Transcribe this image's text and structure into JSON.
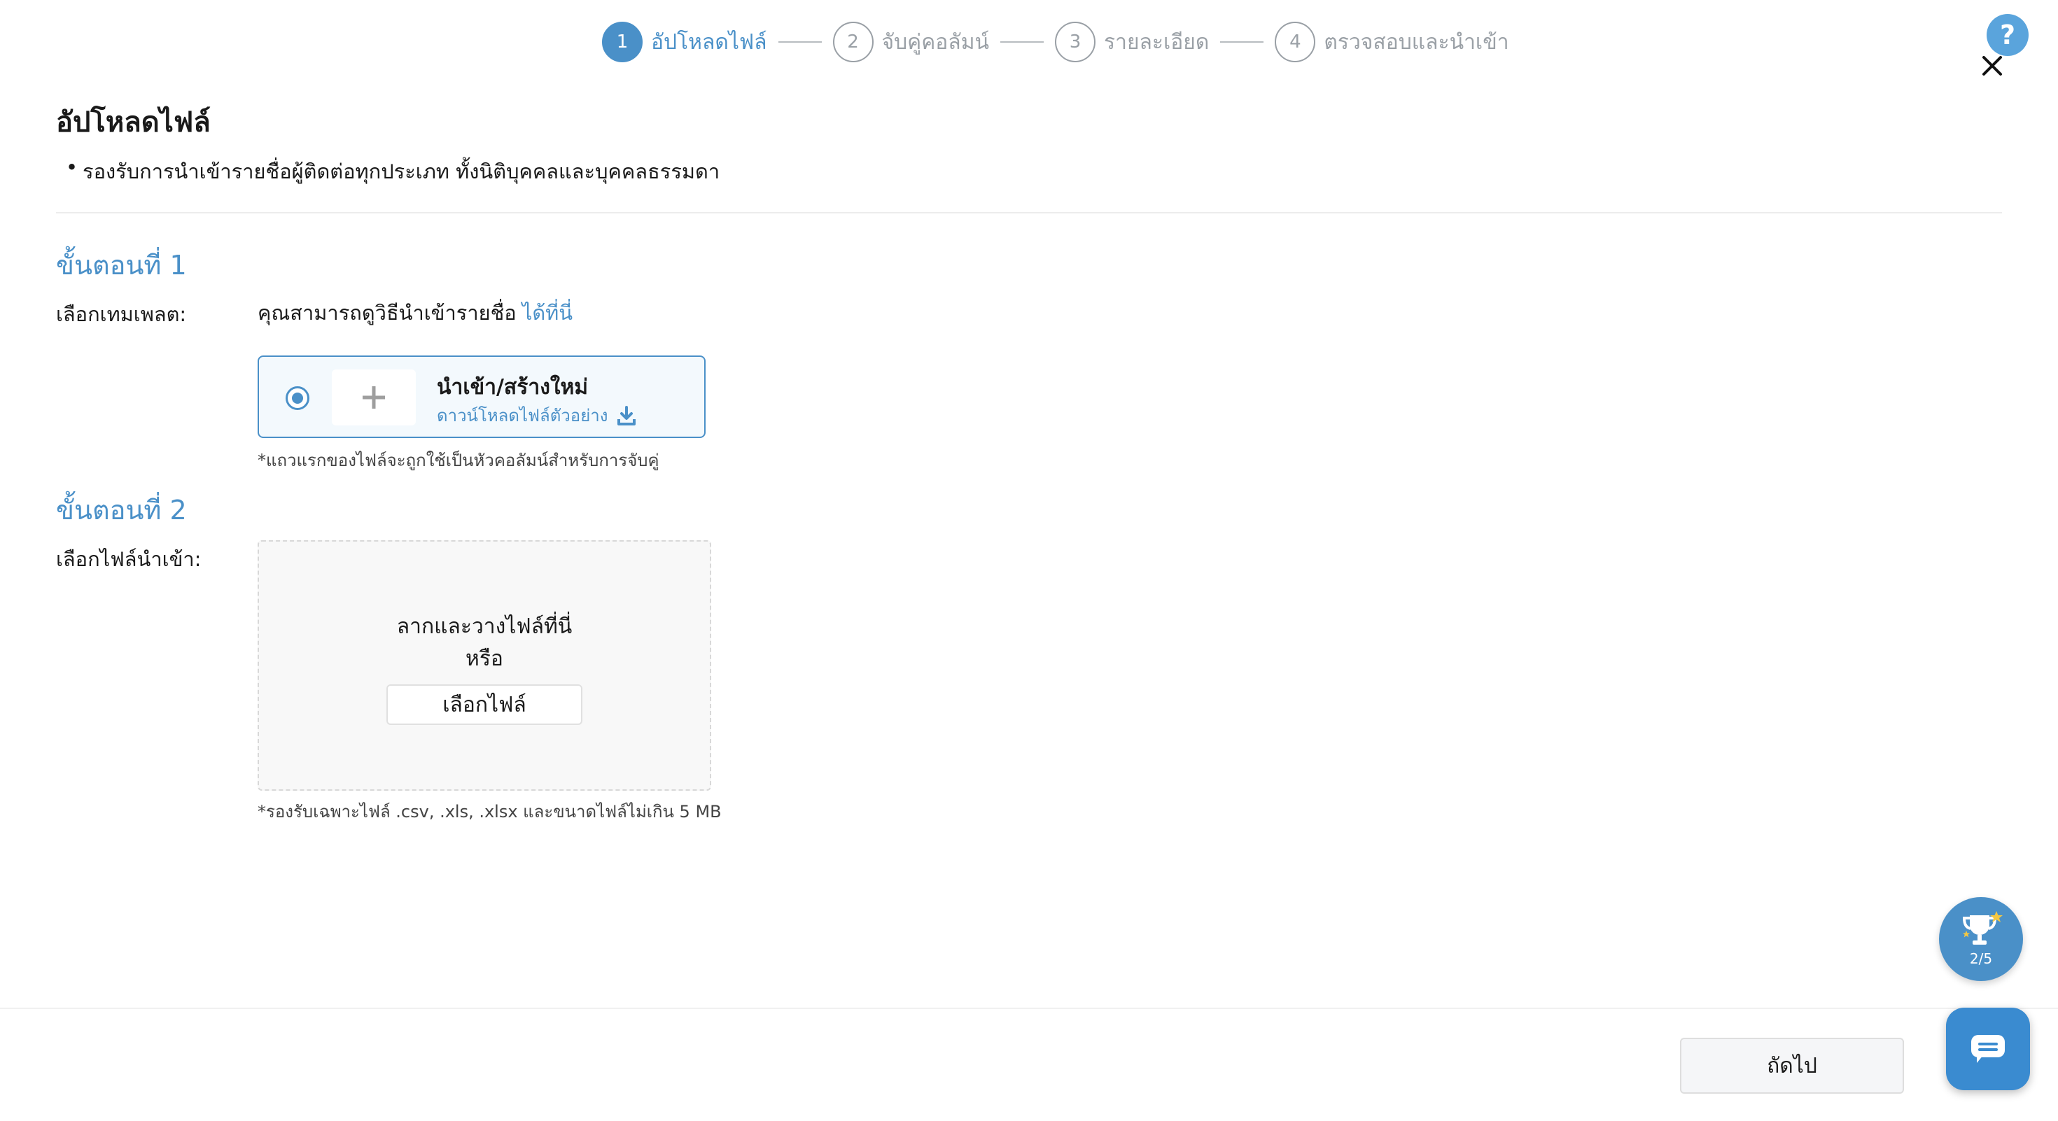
{
  "stepper": [
    {
      "number": "1",
      "label": "อัปโหลดไฟล์",
      "active": true
    },
    {
      "number": "2",
      "label": "จับคู่คอลัมน์",
      "active": false
    },
    {
      "number": "3",
      "label": "รายละเอียด",
      "active": false
    },
    {
      "number": "4",
      "label": "ตรวจสอบและนำเข้า",
      "active": false
    }
  ],
  "header": {
    "help_symbol": "?",
    "title": "อัปโหลดไฟล์",
    "bullet": "รองรับการนำเข้ารายชื่อผู้ติดต่อทุกประเภท ทั้งนิติบุคคลและบุคคลธรรมดา"
  },
  "step1": {
    "title": "ขั้นตอนที่ 1",
    "label": "เลือกเทมเพลต:",
    "hint": "คุณสามารถดูวิธีนำเข้ารายชื่อ",
    "hint_link": "ได้ที่นี่",
    "card": {
      "title": "นำเข้า/สร้างใหม่",
      "download_link": "ดาวน์โหลดไฟล์ตัวอย่าง"
    },
    "note": "*แถวแรกของไฟล์จะถูกใช้เป็นหัวคอลัมน์สำหรับการจับคู่"
  },
  "step2": {
    "title": "ขั้นตอนที่ 2",
    "label": "เลือกไฟล์นำเข้า:",
    "drop_text": "ลากและวางไฟล์ที่นี่",
    "or_text": "หรือ",
    "choose_button": "เลือกไฟล์",
    "note": "*รองรับเฉพาะไฟล์ .csv, .xls, .xlsx และขนาดไฟล์ไม่เกิน 5 MB"
  },
  "footer": {
    "next_button": "ถัดไป"
  },
  "widgets": {
    "trophy_progress": "2/5"
  },
  "colors": {
    "accent": "#4a90c8",
    "inactive": "#9aa0a6"
  }
}
